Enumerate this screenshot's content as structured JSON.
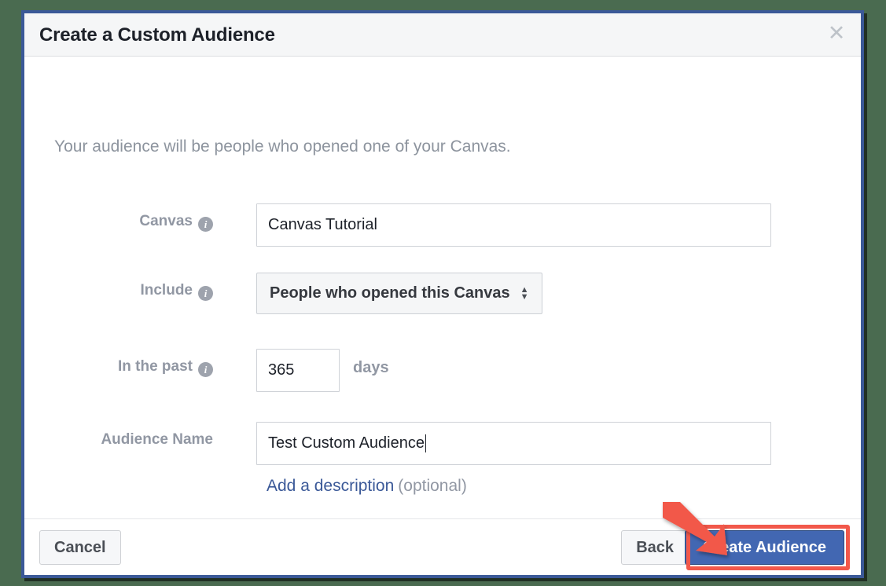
{
  "dialog": {
    "title": "Create a Custom Audience",
    "close_icon": "close-icon",
    "intro": "Your audience will be people who opened one of your Canvas."
  },
  "form": {
    "canvas": {
      "label": "Canvas",
      "info_icon": "info-icon",
      "value": "Canvas Tutorial",
      "placeholder": ""
    },
    "include": {
      "label": "Include",
      "info_icon": "info-icon",
      "selected": "People who opened this Canvas",
      "options": [
        "People who opened this Canvas"
      ]
    },
    "in_the_past": {
      "label": "In the past",
      "info_icon": "info-icon",
      "value": "365",
      "suffix": "days"
    },
    "audience_name": {
      "label": "Audience Name",
      "value": "Test Custom Audience",
      "placeholder": ""
    },
    "description": {
      "link_text": "Add a description",
      "optional_text": "(optional)"
    }
  },
  "footer": {
    "cancel_label": "Cancel",
    "back_label": "Back",
    "create_label": "Create Audience"
  },
  "annotation": {
    "arrow_icon": "arrow-pointer-icon",
    "highlight_color": "#f2584a"
  },
  "colors": {
    "dialog_border": "#3b5998",
    "primary_button": "#4267b2",
    "link": "#3b5998",
    "label_gray": "#9197a3",
    "page_background": "#4a6b50"
  }
}
